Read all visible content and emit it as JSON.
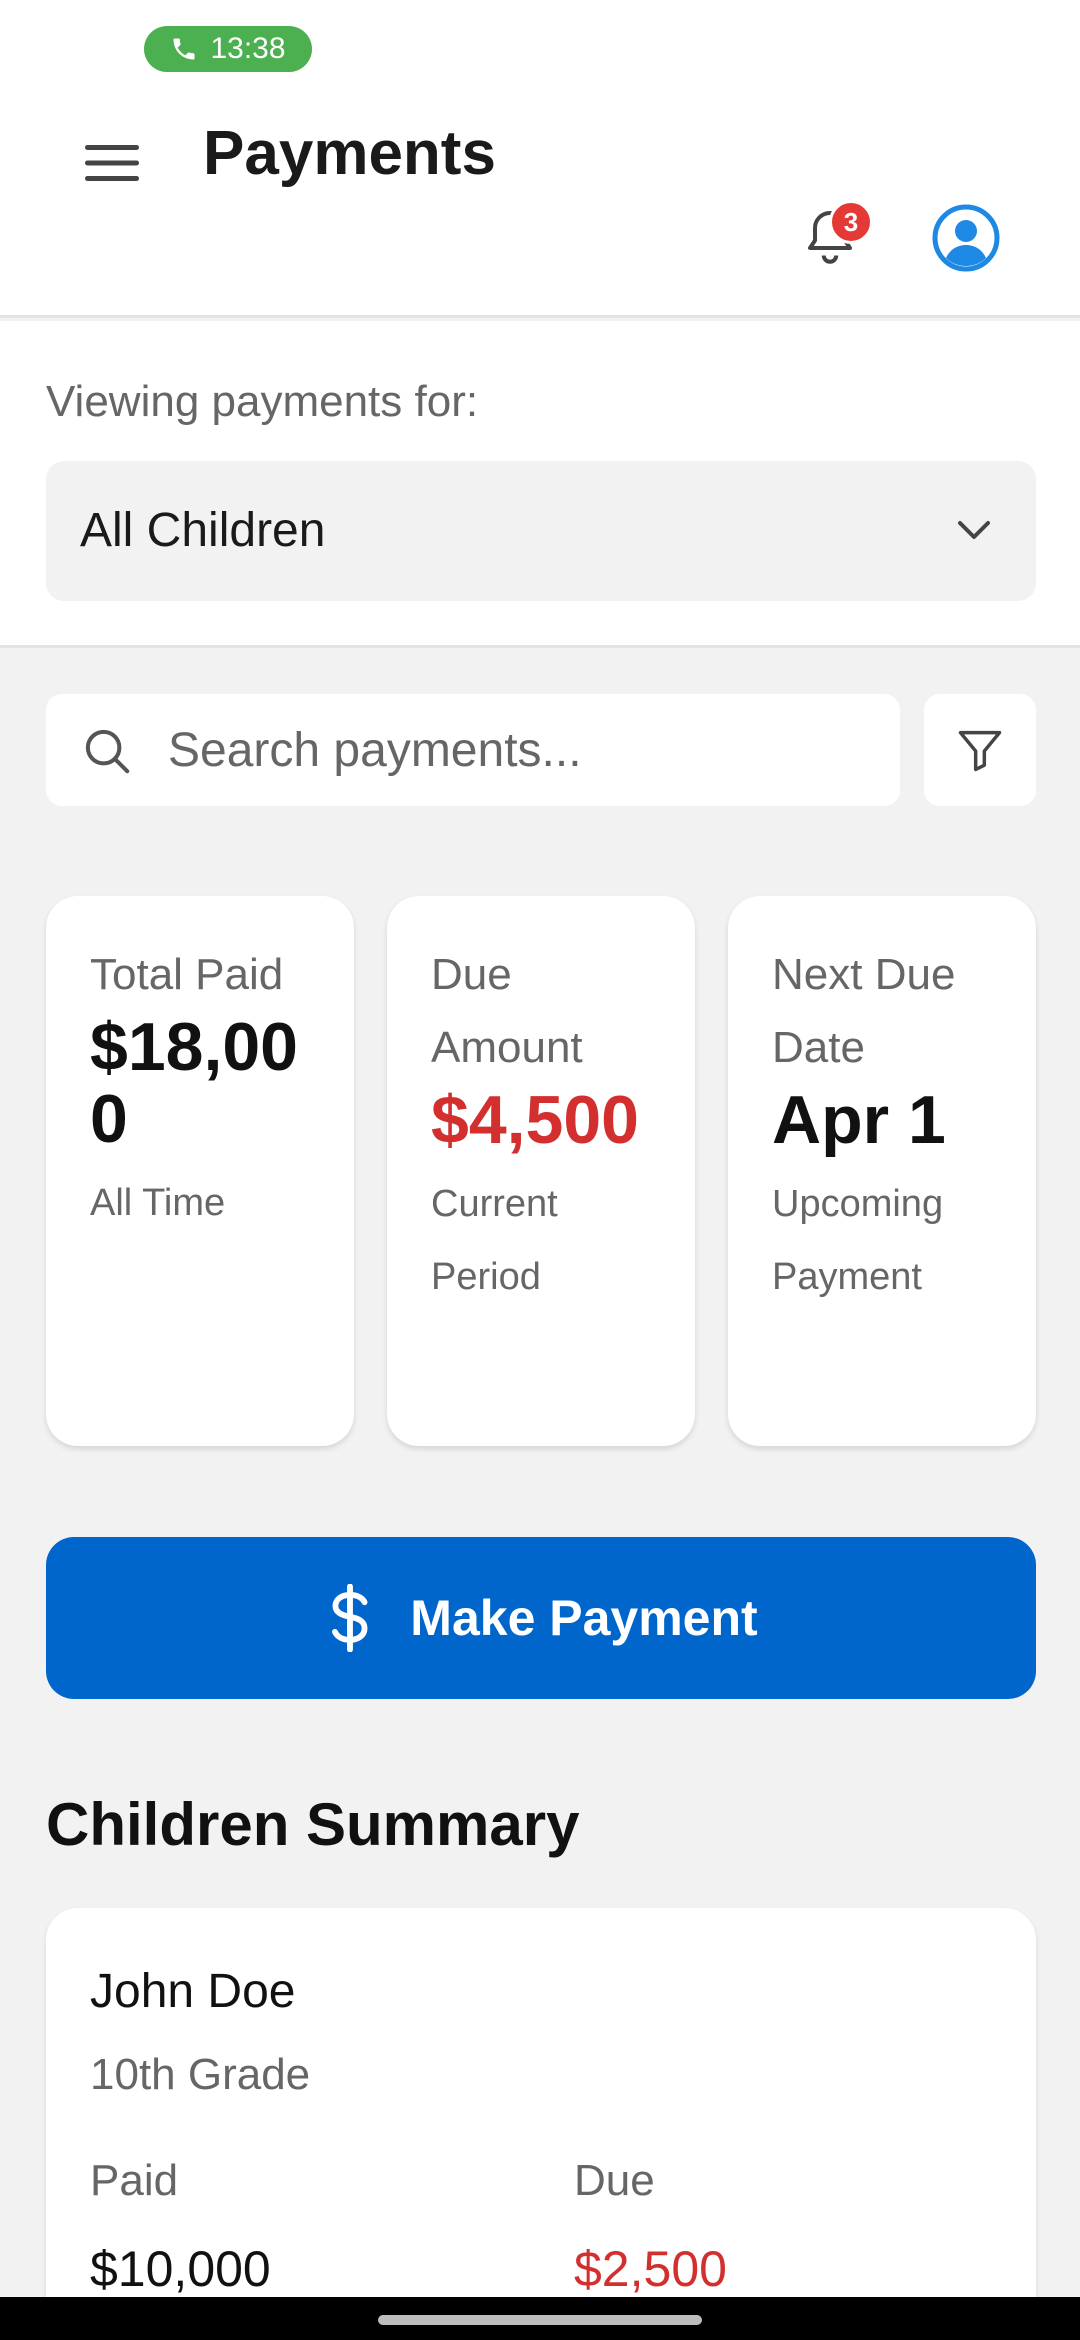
{
  "status_bar": {
    "call_time": "13:38"
  },
  "header": {
    "title": "Payments",
    "notification_count": "3"
  },
  "selector": {
    "label": "Viewing payments for:",
    "selected": "All Children"
  },
  "search": {
    "placeholder": "Search payments..."
  },
  "stats": [
    {
      "label": "Total Paid",
      "value": "$18,000",
      "sub": "All Time"
    },
    {
      "label": "Due Amount",
      "value": "$4,500",
      "sub": "Current Period"
    },
    {
      "label": "Next Due Date",
      "value": "Apr 1",
      "sub": "Upcoming Payment"
    }
  ],
  "actions": {
    "make_payment_label": "Make Payment"
  },
  "children_summary": {
    "title": "Children Summary",
    "children": [
      {
        "name": "John Doe",
        "grade": "10th Grade",
        "paid_label": "Paid",
        "paid_value": "$10,000",
        "due_label": "Due",
        "due_value": "$2,500"
      }
    ]
  },
  "colors": {
    "primary": "#0066cc",
    "danger": "#d32f2f",
    "call_green": "#4caf50",
    "badge_red": "#e53935",
    "avatar_blue": "#1e88e5"
  }
}
